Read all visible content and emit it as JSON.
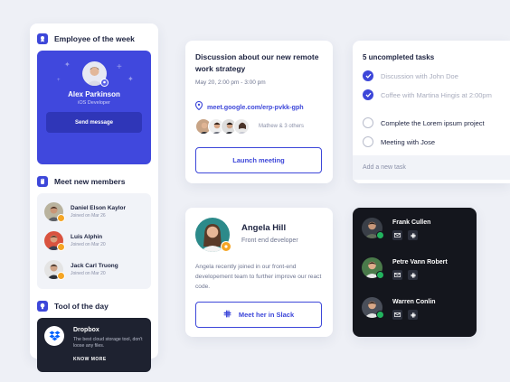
{
  "employee_of_week": {
    "section_title": "Employee of the week",
    "name": "Alex Parkinson",
    "role": "iOS Developer",
    "send_label": "Send message"
  },
  "new_members": {
    "section_title": "Meet new members",
    "items": [
      {
        "name": "Daniel Elson Kaylor",
        "joined": "Joined on Mar 26"
      },
      {
        "name": "Luis Alphin",
        "joined": "Joined on Mar 20"
      },
      {
        "name": "Jack Carl Truong",
        "joined": "Joined on Mar 20"
      }
    ]
  },
  "tool_of_day": {
    "section_title": "Tool of the day",
    "name": "Dropbox",
    "description": "The best cloud storage tool, don't loose any files.",
    "cta": "KNOW MORE"
  },
  "meeting": {
    "title": "Discussion about our new remote work strategy",
    "time": "May 20, 2:00 pm - 3:00 pm",
    "link": "meet.google.com/erp-pvkk-gph",
    "participants_text": "Mathew & 3 others",
    "launch_label": "Launch meeting"
  },
  "tasks": {
    "title": "5 uncompleted tasks",
    "items": [
      {
        "label": "Discussion with John Doe",
        "done": true
      },
      {
        "label": "Coffee with Martina Hingis at 2:00pm",
        "done": true
      },
      {
        "label": "Complete the Lorem ipsum project",
        "done": false
      },
      {
        "label": "Meeting with Jose",
        "done": false
      }
    ],
    "new_task_placeholder": "Add a new task"
  },
  "profile": {
    "name": "Angela Hill",
    "role": "Front end developer",
    "bio": "Angela recently joined in our front-end developement team to further improve our react code.",
    "slack_label": "Meet her in Slack"
  },
  "team": {
    "members": [
      {
        "name": "Frank Cullen"
      },
      {
        "name": "Petre Vann Robert"
      },
      {
        "name": "Warren Conlin"
      }
    ]
  },
  "colors": {
    "accent": "#3d47d9",
    "accent_dark": "#2f36b8",
    "background": "#eef0f6",
    "dark_card": "#14161d",
    "badge_orange": "#f5a524",
    "badge_green": "#22b35e"
  }
}
